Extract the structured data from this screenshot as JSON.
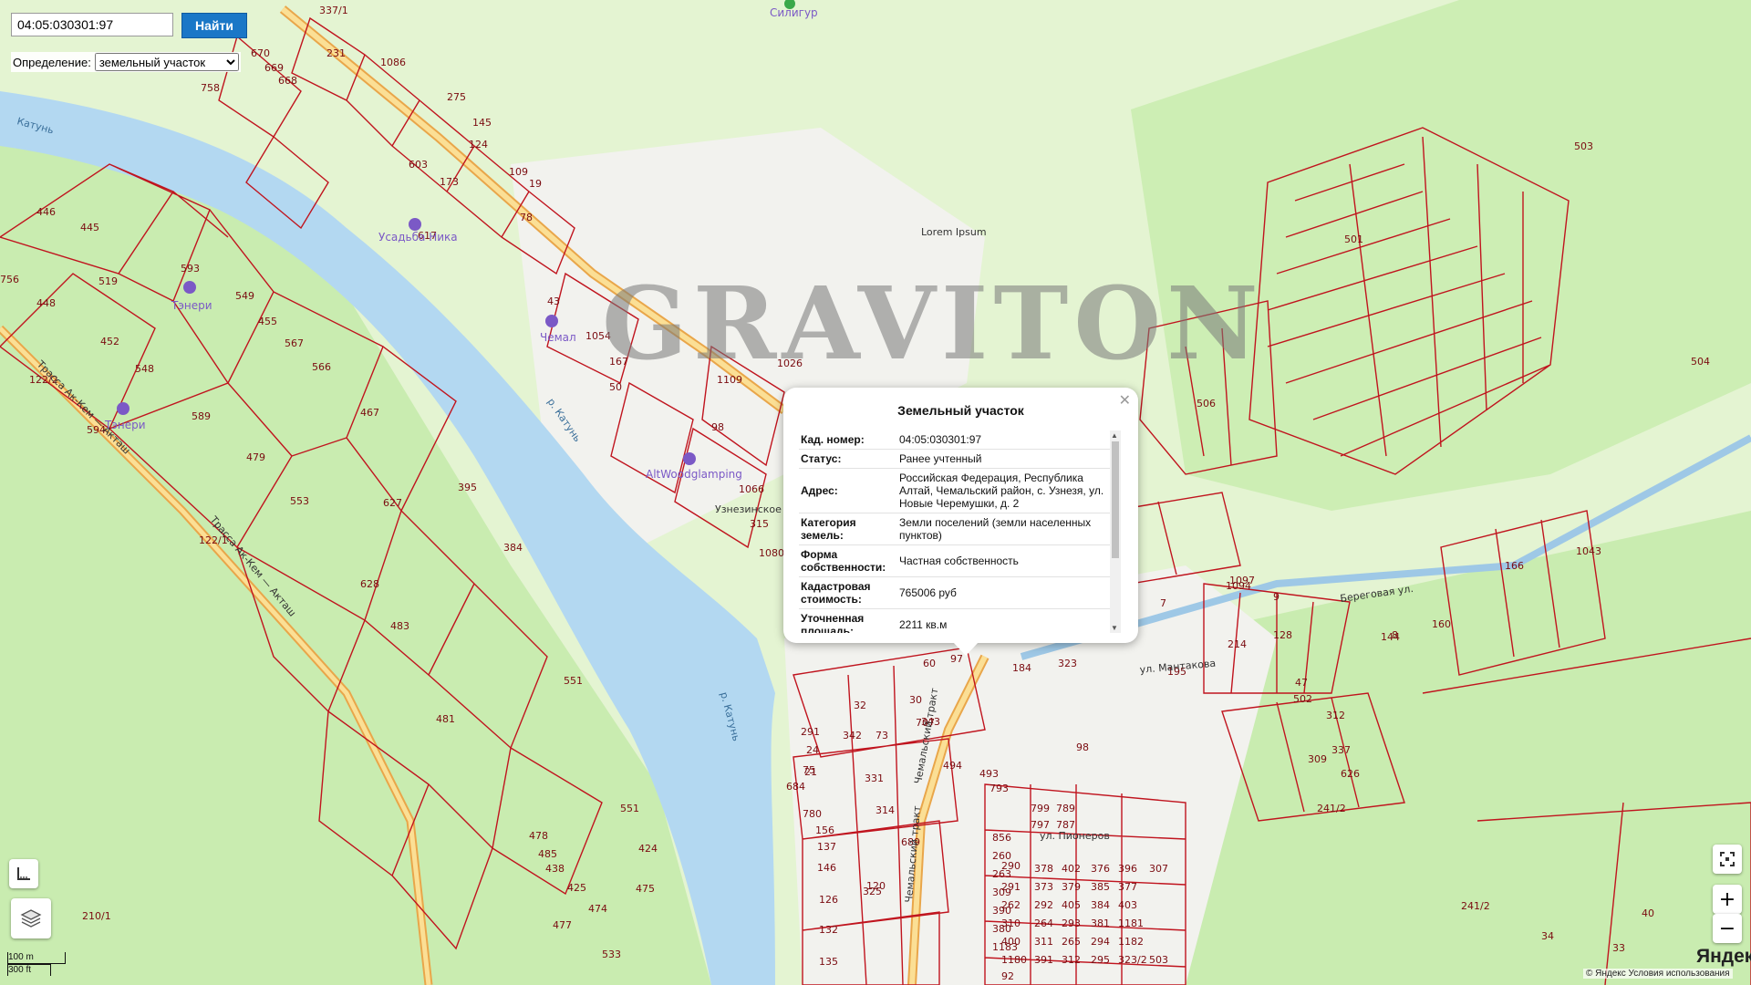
{
  "search": {
    "value": "04:05:030301:97",
    "button_label": "Найти"
  },
  "definition": {
    "label": "Определение:",
    "selected": "земельный участок"
  },
  "watermark": "GRAVITON",
  "popup": {
    "title": "Земельный участок",
    "rows": [
      {
        "key": "Кад. номер:",
        "value": "04:05:030301:97"
      },
      {
        "key": "Статус:",
        "value": "Ранее учтенный"
      },
      {
        "key": "Адрес:",
        "value": "Российская Федерация, Республика Алтай, Чемальский район, с. Узнезя, ул. Новые Черемушки, д. 2"
      },
      {
        "key": "Категория земель:",
        "value": "Земли поселений (земли населенных пунктов)"
      },
      {
        "key": "Форма собственности:",
        "value": "Частная собственность"
      },
      {
        "key": "Кадастровая стоимость:",
        "value": "765006 руб"
      },
      {
        "key": "Уточненная площадь:",
        "value": "2211 кв.м"
      }
    ]
  },
  "map": {
    "roads": [
      {
        "label": "Трасса Ак-Кем — Акташ"
      },
      {
        "label": "Трасса Ак-Кем — Акташ"
      },
      {
        "label": "Чемальский тракт"
      },
      {
        "label": "ул. Мантакова"
      },
      {
        "label": "Береговая ул."
      },
      {
        "label": "ул. Пионеров"
      },
      {
        "label": "Чемальский тракт"
      }
    ],
    "rivers": [
      {
        "label": "р. Катунь"
      },
      {
        "label": "р. Катунь"
      },
      {
        "label": "Катунь"
      }
    ],
    "pois": [
      {
        "label": "Силигур"
      },
      {
        "label": "Усадьба Ника"
      },
      {
        "label": "Тэнери"
      },
      {
        "label": "Тэнери"
      },
      {
        "label": "Чемал"
      },
      {
        "label": "AltWoodglamping"
      },
      {
        "label": "Узнезинское кладбище"
      },
      {
        "label": "Lorem Ipsum"
      }
    ],
    "plots": [
      "337/1",
      "231",
      "1086",
      "670",
      "669",
      "668",
      "758",
      "275",
      "145",
      "124",
      "109",
      "19",
      "603",
      "173",
      "617",
      "78",
      "446",
      "445",
      "593",
      "519",
      "756",
      "448",
      "549",
      "455",
      "452",
      "567",
      "548",
      "566",
      "122/2",
      "589",
      "467",
      "594",
      "479",
      "553",
      "627",
      "395",
      "384",
      "628",
      "483",
      "551",
      "481",
      "551",
      "478",
      "485",
      "438",
      "425",
      "424",
      "475",
      "474",
      "477",
      "533",
      "210/1",
      "122/1",
      "43",
      "1054",
      "167",
      "50",
      "1109",
      "1066",
      "1026",
      "98",
      "315",
      "1080",
      "503",
      "504",
      "506",
      "501",
      "9",
      "7",
      "1097",
      "1094",
      "166",
      "1043",
      "8",
      "160",
      "184",
      "323",
      "60",
      "97",
      "32",
      "30",
      "707",
      "494",
      "493",
      "331",
      "314",
      "689",
      "780",
      "684",
      "156",
      "137",
      "146",
      "126",
      "132",
      "135",
      "793",
      "799",
      "789",
      "797",
      "787",
      "856",
      "260",
      "290",
      "378",
      "402",
      "376",
      "396",
      "307",
      "263",
      "291",
      "373",
      "379",
      "385",
      "377",
      "309",
      "262",
      "292",
      "405",
      "384",
      "403",
      "390",
      "310",
      "264",
      "293",
      "381",
      "1181",
      "380",
      "400",
      "311",
      "265",
      "294",
      "1182",
      "1183",
      "1180",
      "391",
      "312",
      "295",
      "323/2",
      "503",
      "92",
      "98",
      "241/2",
      "241/2",
      "33",
      "34",
      "40",
      "291",
      "24",
      "21",
      "75",
      "120",
      "325",
      "342",
      "343",
      "73",
      "47",
      "502",
      "312",
      "309",
      "337",
      "626",
      "144",
      "128",
      "214",
      "195"
    ],
    "scale": {
      "metric": "100 m",
      "imperial": "300 ft"
    },
    "attribution": {
      "copyright": "© Яндекс Условия использования",
      "logo": "Яндекс"
    },
    "colors": {
      "plot_outline": "#c0141e",
      "river": "#b3d8f1",
      "forest": "#c9ecb0",
      "meadow": "#e4f4d2",
      "road_fill": "#fbdf95",
      "road_edge": "#e9a64a",
      "settlement": "#f2f2ee"
    }
  }
}
